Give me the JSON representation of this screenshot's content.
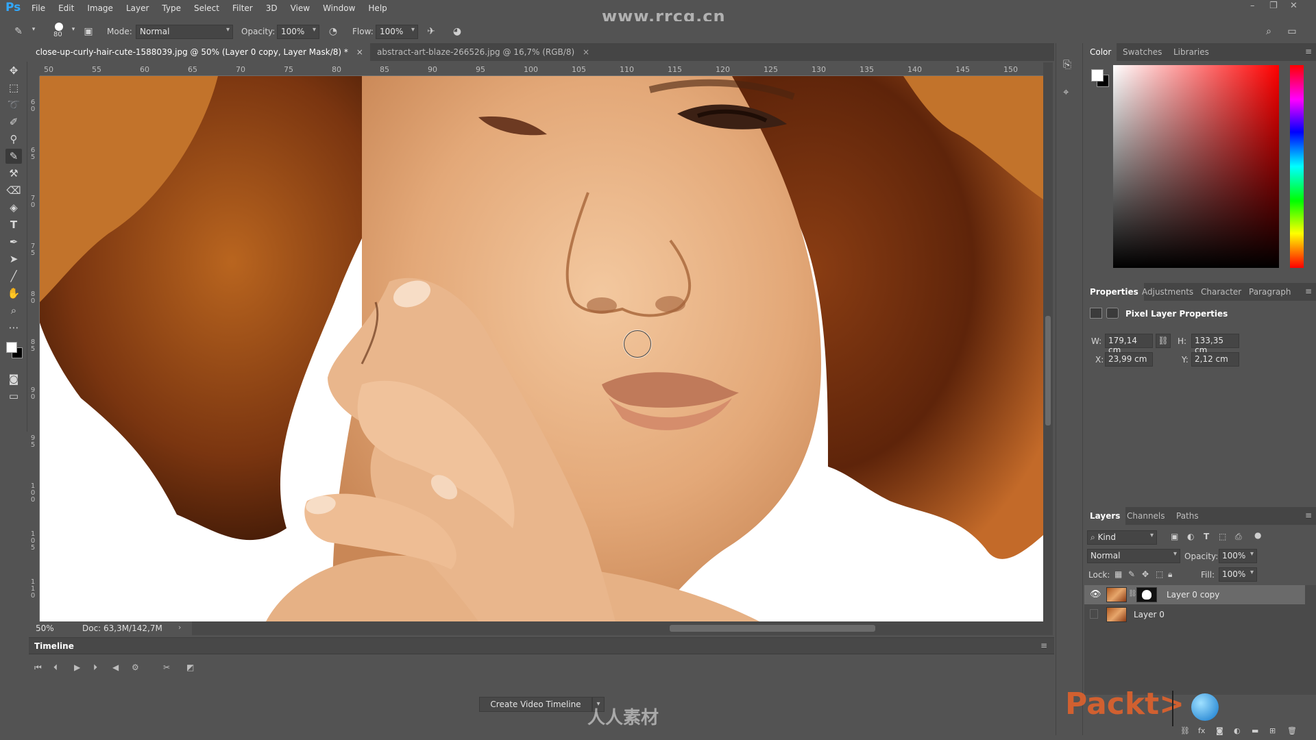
{
  "app": {
    "logo": "Ps",
    "menus": [
      "File",
      "Edit",
      "Image",
      "Layer",
      "Type",
      "Select",
      "Filter",
      "3D",
      "View",
      "Window",
      "Help"
    ],
    "watermark": "www.rrcg.cn"
  },
  "options_bar": {
    "brush_size": "80",
    "mode_label": "Mode:",
    "mode_value": "Normal",
    "opacity_label": "Opacity:",
    "opacity_value": "100%",
    "flow_label": "Flow:",
    "flow_value": "100%"
  },
  "document_tabs": [
    {
      "label": "close-up-curly-hair-cute-1588039.jpg @ 50% (Layer 0 copy, Layer Mask/8) *",
      "active": true
    },
    {
      "label": "abstract-art-blaze-266526.jpg @ 16,7% (RGB/8)",
      "active": false
    }
  ],
  "rulers": {
    "top": [
      "50",
      "55",
      "60",
      "65",
      "70",
      "75",
      "80",
      "85",
      "90",
      "95",
      "100",
      "105",
      "110",
      "115",
      "120",
      "125",
      "130",
      "135",
      "140",
      "145",
      "150"
    ],
    "left": [
      "6 0",
      "6 5",
      "7 0",
      "7 5",
      "8 0",
      "8 5",
      "9 0",
      "9 5",
      "1 0 0",
      "1 0 5",
      "1 1 0"
    ]
  },
  "status": {
    "zoom": "50%",
    "doc_size": "Doc: 63,3M/142,7M"
  },
  "timeline": {
    "title": "Timeline",
    "create_button": "Create Video Timeline"
  },
  "color_panel": {
    "tabs": [
      "Color",
      "Swatches",
      "Libraries"
    ],
    "active_tab": "Color",
    "foreground": "#ffffff",
    "background": "#000000"
  },
  "properties_panel": {
    "tabs": [
      "Properties",
      "Adjustments",
      "Character",
      "Paragraph"
    ],
    "active_tab": "Properties",
    "title": "Pixel Layer Properties",
    "w_label": "W:",
    "w_value": "179,14 cm",
    "h_label": "H:",
    "h_value": "133,35 cm",
    "x_label": "X:",
    "x_value": "23,99 cm",
    "y_label": "Y:",
    "y_value": "2,12 cm"
  },
  "layers_panel": {
    "tabs": [
      "Layers",
      "Channels",
      "Paths"
    ],
    "active_tab": "Layers",
    "filter_value": "Kind",
    "blend_mode": "Normal",
    "opacity_label": "Opacity:",
    "opacity_value": "100%",
    "lock_label": "Lock:",
    "fill_label": "Fill:",
    "fill_value": "100%",
    "layers": [
      {
        "name": "Layer 0 copy",
        "visible": true,
        "selected": true,
        "has_mask": true
      },
      {
        "name": "Layer 0",
        "visible": false,
        "selected": false,
        "has_mask": false
      }
    ]
  },
  "branding": {
    "packt": "Packt>",
    "site_watermark": "人人素材"
  }
}
